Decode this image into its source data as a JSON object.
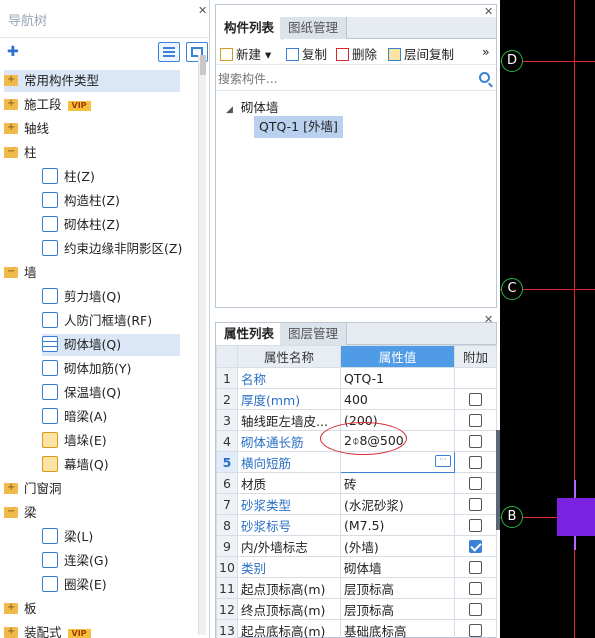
{
  "nav": {
    "title": "导航树",
    "items": [
      {
        "label": "常用构件类型",
        "level": 0,
        "icon": "folder-icon",
        "selected": true
      },
      {
        "label": "施工段",
        "level": 0,
        "icon": "folder-icon",
        "vip": "VIP"
      },
      {
        "label": "轴线",
        "level": 0,
        "icon": "folder-icon"
      },
      {
        "label": "柱",
        "level": 0,
        "icon": "folder-open-icon"
      },
      {
        "label": "柱(Z)",
        "level": 1,
        "icon": "column-icon"
      },
      {
        "label": "构造柱(Z)",
        "level": 1,
        "icon": "constructional-column-icon"
      },
      {
        "label": "砌体柱(Z)",
        "level": 1,
        "icon": "masonry-column-icon"
      },
      {
        "label": "约束边缘非阴影区(Z)",
        "level": 1,
        "icon": "boundary-zone-icon"
      },
      {
        "label": "墙",
        "level": 0,
        "icon": "folder-open-icon"
      },
      {
        "label": "剪力墙(Q)",
        "level": 1,
        "icon": "shear-wall-icon"
      },
      {
        "label": "人防门框墙(RF)",
        "level": 1,
        "icon": "civil-defense-door-wall-icon"
      },
      {
        "label": "砌体墙(Q)",
        "level": 1,
        "icon": "masonry-wall-icon",
        "selected": true
      },
      {
        "label": "砌体加筋(Y)",
        "level": 1,
        "icon": "masonry-reinforcement-icon"
      },
      {
        "label": "保温墙(Q)",
        "level": 1,
        "icon": "insulation-wall-icon"
      },
      {
        "label": "暗梁(A)",
        "level": 1,
        "icon": "hidden-beam-icon"
      },
      {
        "label": "墙垛(E)",
        "level": 1,
        "icon": "wall-pier-icon"
      },
      {
        "label": "幕墙(Q)",
        "level": 1,
        "icon": "curtain-wall-icon"
      },
      {
        "label": "门窗洞",
        "level": 0,
        "icon": "folder-icon"
      },
      {
        "label": "梁",
        "level": 0,
        "icon": "folder-open-icon"
      },
      {
        "label": "梁(L)",
        "level": 1,
        "icon": "beam-icon"
      },
      {
        "label": "连梁(G)",
        "level": 1,
        "icon": "coupling-beam-icon"
      },
      {
        "label": "圈梁(E)",
        "level": 1,
        "icon": "ring-beam-icon"
      },
      {
        "label": "板",
        "level": 0,
        "icon": "folder-icon"
      },
      {
        "label": "装配式",
        "level": 0,
        "icon": "folder-icon",
        "vip": "VIP"
      }
    ]
  },
  "component_panel": {
    "tabs": [
      "构件列表",
      "图纸管理"
    ],
    "toolbar": {
      "new": "新建",
      "copy": "复制",
      "delete": "删除",
      "floor_copy": "层间复制"
    },
    "search_placeholder": "搜索构件...",
    "group": "砌体墙",
    "item": "QTQ-1 [外墙]"
  },
  "property_panel": {
    "tabs": [
      "属性列表",
      "图层管理"
    ],
    "columns": [
      "属性名称",
      "属性值",
      "附加"
    ],
    "rows": [
      {
        "n": "1",
        "name": "名称",
        "value": "QTQ-1",
        "blue": true,
        "check": null
      },
      {
        "n": "2",
        "name": "厚度(mm)",
        "value": "400",
        "blue": true,
        "check": false
      },
      {
        "n": "3",
        "name": "轴线距左墙皮...",
        "value": "(200)",
        "blue": false,
        "check": false
      },
      {
        "n": "4",
        "name": "砌体通长筋",
        "value": "2⌽8@500",
        "blue": true,
        "check": false
      },
      {
        "n": "5",
        "name": "横向短筋",
        "value": "",
        "blue": true,
        "check": false,
        "editing": true
      },
      {
        "n": "6",
        "name": "材质",
        "value": "砖",
        "blue": false,
        "check": false
      },
      {
        "n": "7",
        "name": "砂浆类型",
        "value": "(水泥砂浆)",
        "blue": true,
        "check": false
      },
      {
        "n": "8",
        "name": "砂浆标号",
        "value": "(M7.5)",
        "blue": true,
        "check": false
      },
      {
        "n": "9",
        "name": "内/外墙标志",
        "value": "(外墙)",
        "blue": false,
        "check": true
      },
      {
        "n": "10",
        "name": "类别",
        "value": "砌体墙",
        "blue": true,
        "check": false
      },
      {
        "n": "11",
        "name": "起点顶标高(m)",
        "value": "层顶标高",
        "blue": false,
        "check": false
      },
      {
        "n": "12",
        "name": "终点顶标高(m)",
        "value": "层顶标高",
        "blue": false,
        "check": false
      },
      {
        "n": "13",
        "name": "起点底标高(m)",
        "value": "基础底标高",
        "blue": false,
        "check": false
      }
    ]
  },
  "cad": {
    "axes": [
      "D",
      "C",
      "B"
    ]
  },
  "colors": {
    "accent": "#3b82d6",
    "header_blue": "#4f9be6",
    "grid_red": "#e32626",
    "axis_green": "#2fb44a",
    "wall_purple": "#7a22e0"
  }
}
